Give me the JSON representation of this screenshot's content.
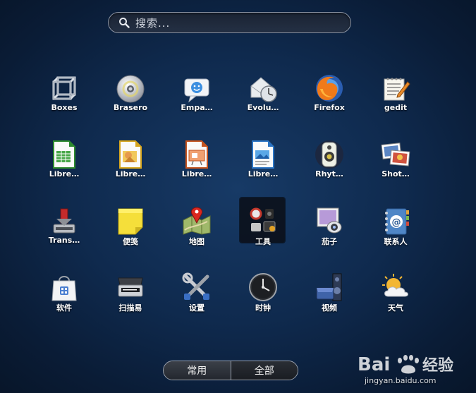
{
  "search": {
    "placeholder": "搜索..."
  },
  "apps": [
    {
      "label": "Boxes",
      "icon": "boxes-icon"
    },
    {
      "label": "Brasero",
      "icon": "brasero-disc-icon"
    },
    {
      "label": "Empa…",
      "icon": "empathy-chat-icon"
    },
    {
      "label": "Evolu…",
      "icon": "evolution-mail-icon"
    },
    {
      "label": "Firefox",
      "icon": "firefox-icon"
    },
    {
      "label": "gedit",
      "icon": "gedit-icon"
    },
    {
      "label": "Libre…",
      "icon": "libreoffice-calc-icon"
    },
    {
      "label": "Libre…",
      "icon": "libreoffice-draw-icon"
    },
    {
      "label": "Libre…",
      "icon": "libreoffice-impress-icon"
    },
    {
      "label": "Libre…",
      "icon": "libreoffice-writer-icon"
    },
    {
      "label": "Rhyt…",
      "icon": "rhythmbox-speaker-icon"
    },
    {
      "label": "Shot…",
      "icon": "shotwell-photos-icon"
    },
    {
      "label": "Trans…",
      "icon": "transmission-icon"
    },
    {
      "label": "便笺",
      "icon": "sticky-notes-icon"
    },
    {
      "label": "地图",
      "icon": "maps-icon"
    },
    {
      "label": "工具",
      "icon": "utilities-folder-icon",
      "selected": true
    },
    {
      "label": "茄子",
      "icon": "cheese-webcam-icon"
    },
    {
      "label": "联系人",
      "icon": "contacts-icon"
    },
    {
      "label": "软件",
      "icon": "software-bag-icon"
    },
    {
      "label": "扫描易",
      "icon": "scanner-icon"
    },
    {
      "label": "设置",
      "icon": "settings-tools-icon"
    },
    {
      "label": "时钟",
      "icon": "clock-icon"
    },
    {
      "label": "视频",
      "icon": "videos-icon"
    },
    {
      "label": "天气",
      "icon": "weather-icon"
    }
  ],
  "switcher": {
    "frequent": "常用",
    "all": "全部",
    "active": "all"
  },
  "watermark": {
    "logo_text": "Bai 经验",
    "url": "jingyan.baidu.com"
  }
}
